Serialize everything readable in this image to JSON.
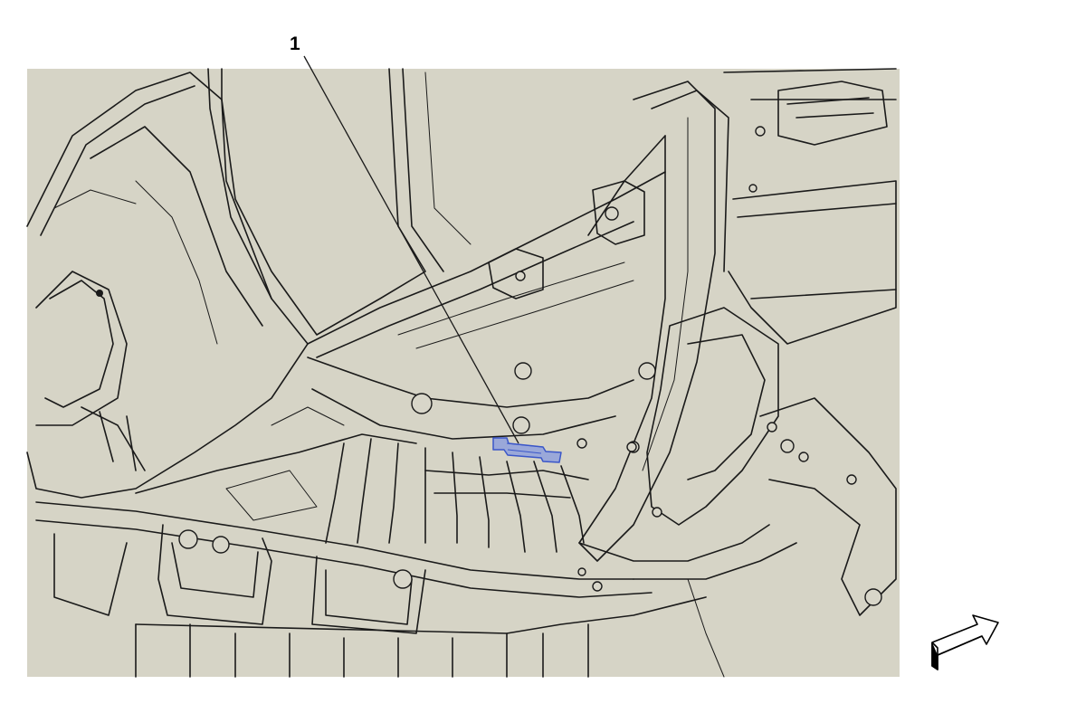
{
  "callouts": [
    {
      "number": "1"
    }
  ],
  "colors": {
    "panel_fill": "#d6d4c6",
    "line": "#1a1a1a",
    "highlight_fill": "#9aa8d9",
    "highlight_stroke": "#3a56c9",
    "background": "#ffffff"
  },
  "icons": {
    "direction_arrow": "front-direction-arrow-icon"
  }
}
